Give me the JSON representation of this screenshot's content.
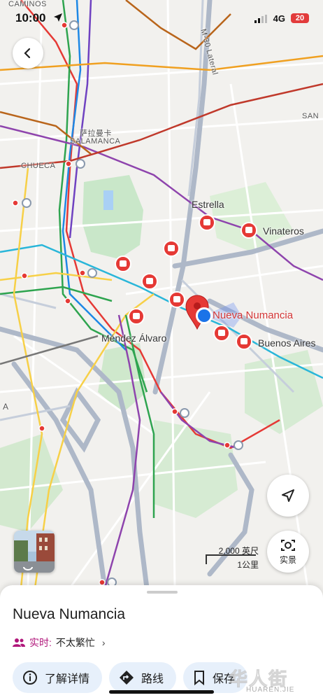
{
  "status_bar": {
    "time": "10:00",
    "network": "4G",
    "battery": "20"
  },
  "map": {
    "labels": {
      "caminos": "CAMINOS",
      "salamanca_cn": "萨拉曼卡",
      "salamanca": "SALAMANCA",
      "chueca": "CHUECA",
      "m30": "M-30 Lateral",
      "san": "SAN",
      "estrella": "Estrella",
      "vinateros": "Vinateros",
      "mendez": "Méndez Álvaro",
      "buenos_aires": "Buenos Aires",
      "a_left": "A"
    },
    "destination_label": "Nueva Numancia",
    "scale": {
      "imperial": "2,000 英尺",
      "metric": "1公里"
    },
    "lens_label": "实景"
  },
  "sheet": {
    "place_name": "Nueva Numancia",
    "live_key": "实时:",
    "live_value": "不太繁忙",
    "actions": {
      "details": "了解详情",
      "route": "路线",
      "save": "保存"
    }
  },
  "watermark": {
    "main": "华人街",
    "sub": "HUAREN.JIE"
  },
  "icons": [
    "location-arrow-icon",
    "back-icon",
    "navigation-icon",
    "lens-icon",
    "people-icon",
    "info-icon",
    "directions-icon",
    "bookmark-icon",
    "metro-icon"
  ],
  "colors": {
    "accent": "#1a73e8",
    "pin": "#e53935",
    "live": "#b0167a",
    "pill_bg": "#e7f0fb"
  }
}
